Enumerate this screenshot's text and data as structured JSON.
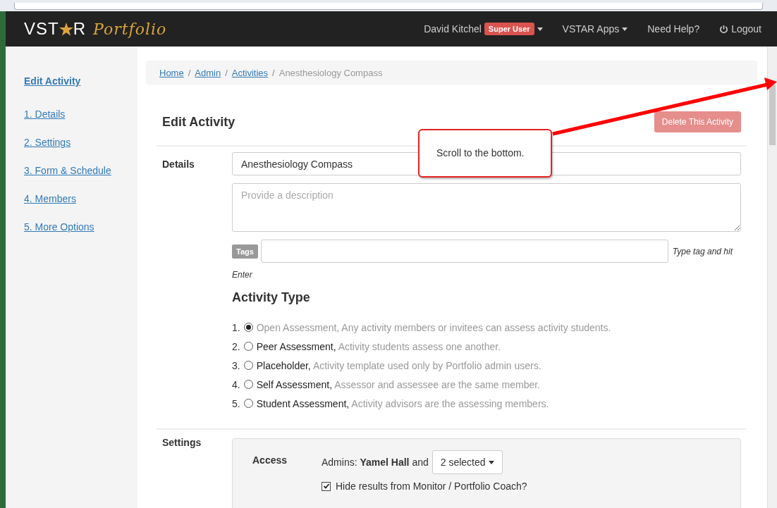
{
  "brand": {
    "prefix": "VST",
    "suffix": "R",
    "script": "Portfolio"
  },
  "nav": {
    "user": "David Kitchel",
    "role_badge": "Super User",
    "apps": "VSTAR Apps",
    "help": "Need Help?",
    "logout": "Logout"
  },
  "sidebar": {
    "items": [
      {
        "label": "Edit Activity",
        "selected": true
      },
      {
        "label": "1. Details",
        "selected": false
      },
      {
        "label": "2. Settings",
        "selected": false
      },
      {
        "label": "3. Form & Schedule",
        "selected": false
      },
      {
        "label": "4. Members",
        "selected": false
      },
      {
        "label": "5. More Options",
        "selected": false
      }
    ]
  },
  "breadcrumb": {
    "links": [
      "Home",
      "Admin",
      "Activities"
    ],
    "separator": "/",
    "current": "Anesthesiology Compass"
  },
  "page_title": "Edit Activity",
  "delete_button": "Delete This Activity",
  "details": {
    "label": "Details",
    "name_value": "Anesthesiology Compass",
    "description_placeholder": "Provide a description",
    "tags_label": "Tags",
    "tags_hint": "Type tag and hit",
    "tags_hint_wrap": "Enter"
  },
  "activity_type": {
    "title": "Activity Type",
    "options": [
      {
        "number": "1.",
        "name": "Open Assessment,",
        "description": "Any activity members or invitees can assess activity students.",
        "selected": true
      },
      {
        "number": "2.",
        "name": "Peer Assessment,",
        "description": "Activity students assess one another.",
        "selected": false
      },
      {
        "number": "3.",
        "name": "Placeholder,",
        "description": "Activity template used only by Portfolio admin users.",
        "selected": false
      },
      {
        "number": "4.",
        "name": "Self Assessment,",
        "description": "Assessor and assessee are the same member.",
        "selected": false
      },
      {
        "number": "5.",
        "name": "Student Assessment,",
        "description": "Activity advisors are the assessing members.",
        "selected": false
      }
    ]
  },
  "settings": {
    "label": "Settings",
    "access_label": "Access",
    "admins": "Admins: **Yamel Hall** and",
    "dropdown": "2 selected",
    "hide_results": {
      "label": "Hide results from Monitor / Portfolio Coach?",
      "checked": true
    }
  },
  "callout": {
    "text": "Scroll to the bottom."
  }
}
